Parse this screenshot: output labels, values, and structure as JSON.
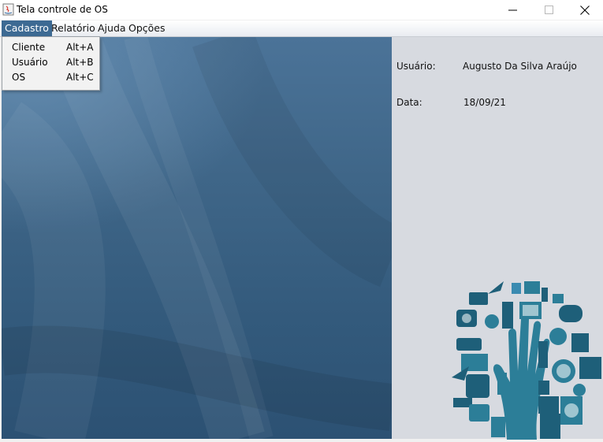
{
  "window": {
    "title": "Tela controle de OS",
    "controls": {
      "minimize": "minimize-icon",
      "maximize": "maximize-icon",
      "close": "close-icon"
    }
  },
  "menubar": {
    "items": [
      {
        "label": "Cadastro",
        "active": true
      },
      {
        "label": "Relatório",
        "active": false
      },
      {
        "label": "Ajuda",
        "active": false
      },
      {
        "label": "Opções",
        "active": false
      }
    ]
  },
  "cadastro_menu": {
    "items": [
      {
        "label": "Cliente",
        "accelerator": "Alt+A"
      },
      {
        "label": "Usuário",
        "accelerator": "Alt+B"
      },
      {
        "label": "OS",
        "accelerator": "Alt+C"
      }
    ]
  },
  "info": {
    "user_label": "Usuário:",
    "user_value": "Augusto Da Silva Araújo",
    "date_label": "Data:",
    "date_value": "18/09/21"
  },
  "colors": {
    "menu_active": "#3d6a93",
    "desktop": "#3f6688",
    "panel": "#d7dae0",
    "illustration": "#1f6b86"
  },
  "illustration": {
    "icon": "technology-hand-icon"
  }
}
